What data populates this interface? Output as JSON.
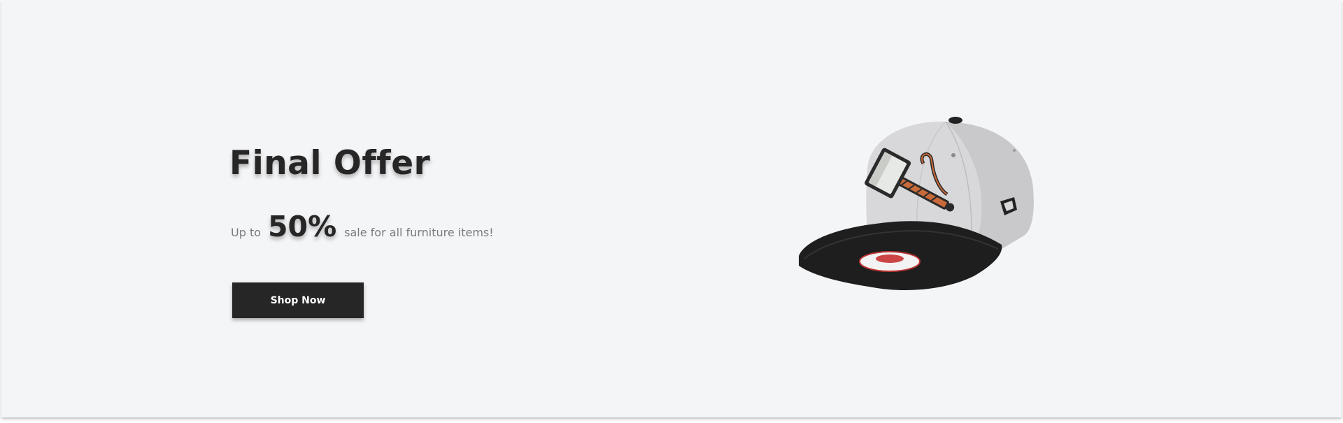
{
  "hero": {
    "title": "Final Offer",
    "subtitle_prefix": "Up to",
    "discount": "50%",
    "subtitle_suffix": "sale for all furniture items!",
    "button_label": "Shop Now"
  },
  "product_image": {
    "icon": "baseball-cap-image"
  },
  "colors": {
    "background": "#f4f5f7",
    "text_dark": "#262626",
    "text_muted": "#7a7a7a",
    "button_bg": "#262626",
    "button_text": "#ffffff"
  }
}
